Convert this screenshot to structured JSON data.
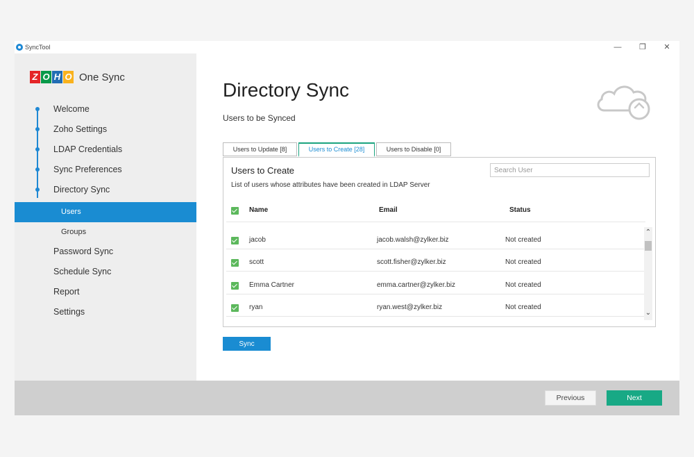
{
  "window": {
    "app_name": "SyncTool",
    "minimize": "—",
    "restore": "❐",
    "close": "✕"
  },
  "brand": {
    "letters": [
      "Z",
      "O",
      "H",
      "O"
    ],
    "letter_colors": [
      "#e42527",
      "#089949",
      "#226db4",
      "#f9b21d"
    ],
    "product": "One Sync"
  },
  "sidebar": {
    "items": [
      {
        "label": "Welcome"
      },
      {
        "label": "Zoho Settings"
      },
      {
        "label": "LDAP Credentials"
      },
      {
        "label": "Sync Preferences"
      },
      {
        "label": "Directory Sync"
      },
      {
        "label": "Users"
      },
      {
        "label": "Groups"
      },
      {
        "label": "Password Sync"
      },
      {
        "label": "Schedule Sync"
      },
      {
        "label": "Report"
      },
      {
        "label": "Settings"
      }
    ]
  },
  "main": {
    "title": "Directory Sync",
    "subtitle": "Users to be Synced",
    "tabs": [
      {
        "label": "Users to Update [8]"
      },
      {
        "label": "Users to Create [28]"
      },
      {
        "label": "Users to Disable [0]"
      }
    ],
    "panel": {
      "title": "Users to Create",
      "description": "List of users whose attributes have been created in LDAP Server",
      "search_placeholder": "Search User",
      "columns": [
        "Name",
        "Email",
        "Status"
      ],
      "rows": [
        {
          "name": "jacob",
          "email": "jacob.walsh@zylker.biz",
          "status": "Not created"
        },
        {
          "name": "scott",
          "email": "scott.fisher@zylker.biz",
          "status": "Not created"
        },
        {
          "name": "Emma Cartner",
          "email": "emma.cartner@zylker.biz",
          "status": "Not created"
        },
        {
          "name": "ryan",
          "email": "ryan.west@zylker.biz",
          "status": "Not created"
        }
      ],
      "scroll_up": "⌃",
      "scroll_down": "⌄"
    },
    "sync_button": "Sync"
  },
  "footer": {
    "previous": "Previous",
    "next": "Next"
  },
  "colors": {
    "accent_blue": "#1a8cd2",
    "accent_green": "#18a985",
    "checkbox_green": "#5cb85c"
  }
}
